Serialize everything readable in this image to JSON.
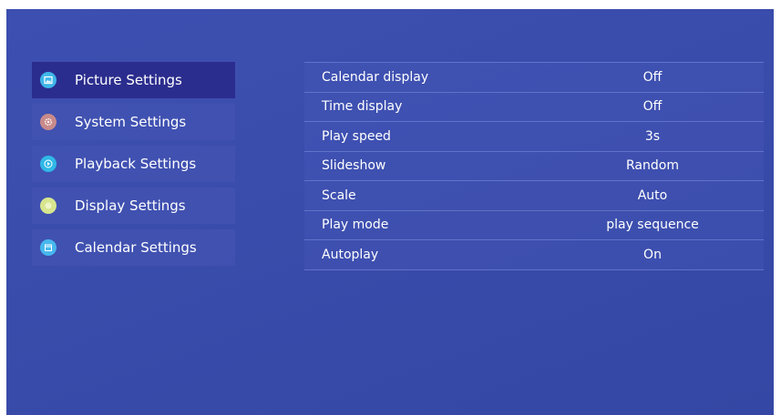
{
  "sidebar": {
    "items": [
      {
        "label": "Picture Settings",
        "icon": "picture-icon",
        "color": "#3fb6e8",
        "active": true
      },
      {
        "label": "System Settings",
        "icon": "gear-icon",
        "color": "#c98a8a",
        "active": false
      },
      {
        "label": "Playback Settings",
        "icon": "play-icon",
        "color": "#2fb8e6",
        "active": false
      },
      {
        "label": "Display Settings",
        "icon": "display-icon",
        "color": "#d7e58e",
        "active": false
      },
      {
        "label": "Calendar Settings",
        "icon": "calendar-icon",
        "color": "#47b8ee",
        "active": false
      }
    ]
  },
  "settings": {
    "rows": [
      {
        "label": "Calendar display",
        "value": "Off"
      },
      {
        "label": "Time display",
        "value": "Off"
      },
      {
        "label": "Play speed",
        "value": "3s"
      },
      {
        "label": "Slideshow",
        "value": "Random"
      },
      {
        "label": "Scale",
        "value": "Auto"
      },
      {
        "label": "Play mode",
        "value": "play sequence"
      },
      {
        "label": "Autoplay",
        "value": "On"
      }
    ]
  },
  "colors": {
    "background": "#3a4cab",
    "active_item": "#2b2d8e",
    "text": "#ffffff"
  }
}
